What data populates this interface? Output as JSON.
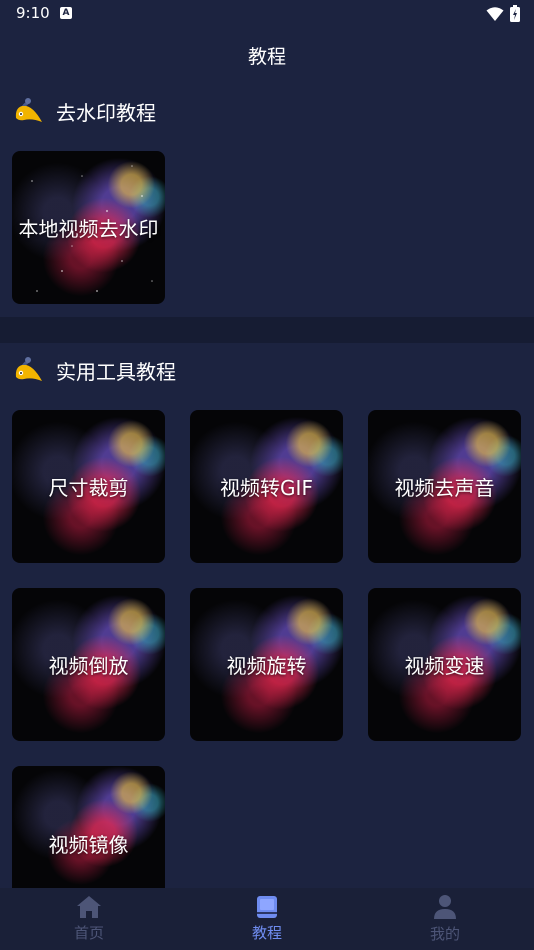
{
  "status": {
    "time": "9:10",
    "notification_badge": "A"
  },
  "header": {
    "title": "教程"
  },
  "sections": [
    {
      "title": "去水印教程",
      "cards": [
        "本地视频去水印"
      ]
    },
    {
      "title": "实用工具教程",
      "cards": [
        "尺寸裁剪",
        "视频转GIF",
        "视频去声音",
        "视频倒放",
        "视频旋转",
        "视频变速",
        "视频镜像"
      ]
    }
  ],
  "nav": {
    "home": "首页",
    "tutorial": "教程",
    "mine": "我的"
  },
  "colors": {
    "background": "#1c2340",
    "nav_active": "#6f8cf0",
    "nav_inactive": "#4d5577"
  }
}
